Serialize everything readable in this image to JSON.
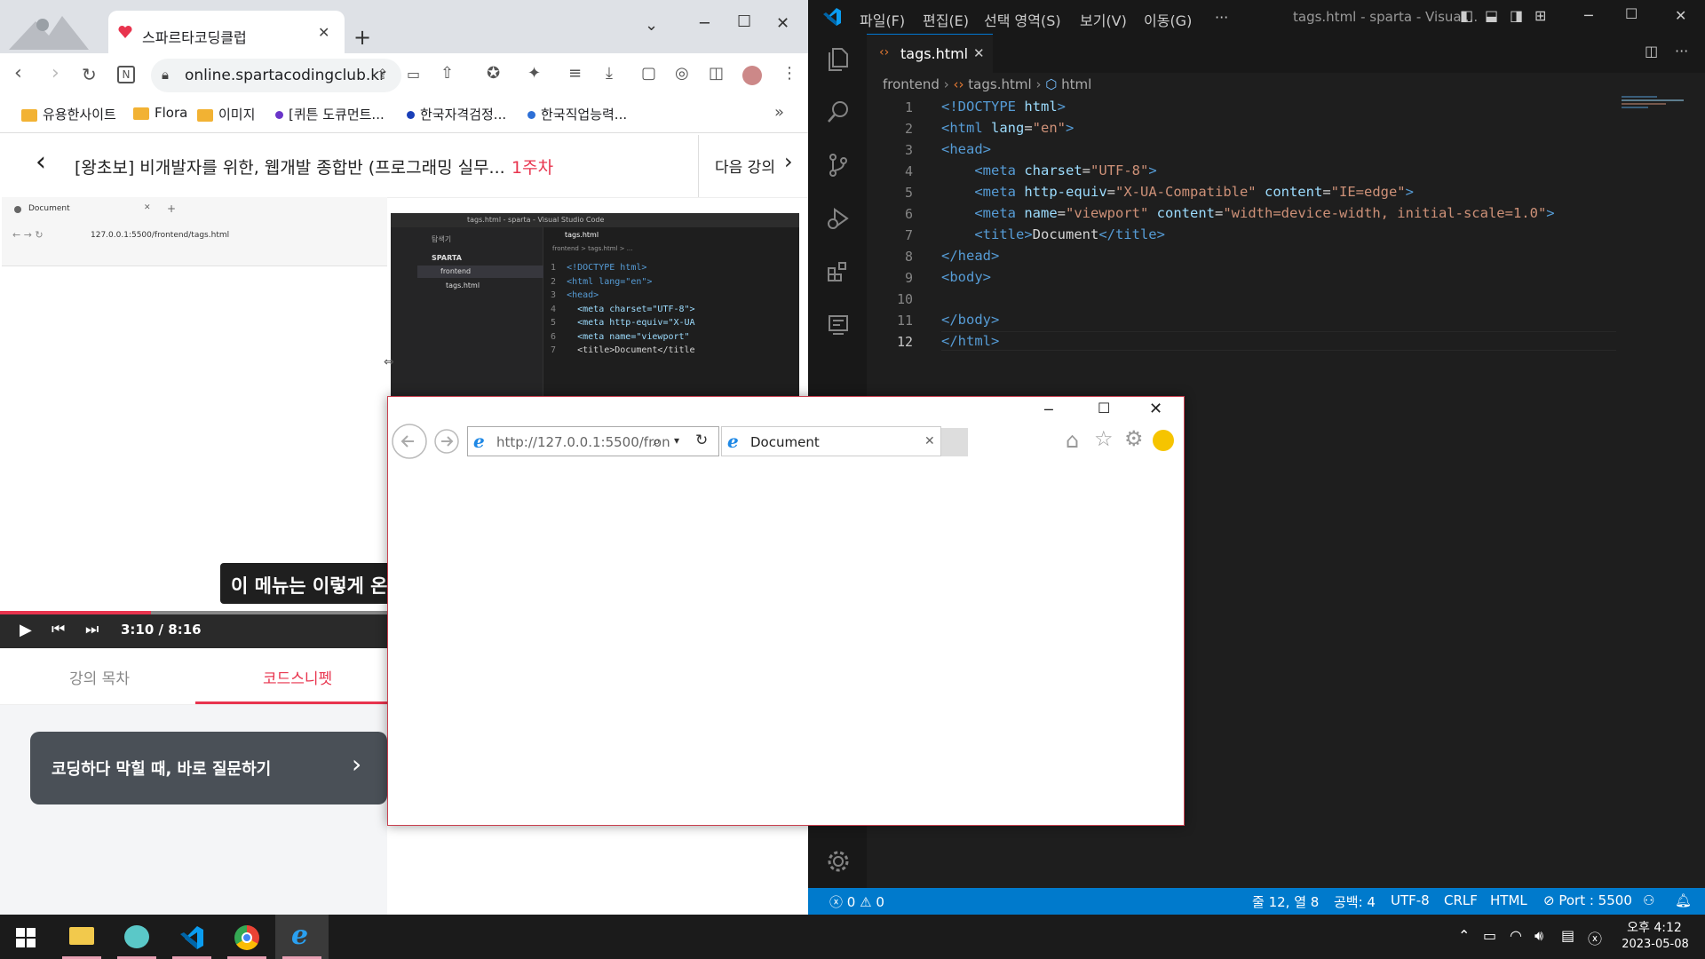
{
  "chrome": {
    "tab_title": "스파르타코딩클럽",
    "url": "online.spartacodingclub.kr",
    "bookmarks": [
      {
        "label": "유용한사이트",
        "kind": "folder"
      },
      {
        "label": "Flora",
        "kind": "folder"
      },
      {
        "label": "이미지",
        "kind": "folder"
      },
      {
        "label": "[퀴튼 도큐먼트...",
        "kind": "dot",
        "color": "#6a35c9"
      },
      {
        "label": "한국자격검정...",
        "kind": "dot",
        "color": "#1a3fb8"
      },
      {
        "label": "한국직업능력...",
        "kind": "dot",
        "color": "#2d6fd6"
      }
    ]
  },
  "lecture": {
    "title": "[왕초보] 비개발자를 위한, 웹개발 종합반 (프로그래밍 실무...",
    "week": "1주차",
    "next_label": "다음 강의",
    "subtitle": "이 메뉴는 이렇게 온",
    "time_current": "3:10",
    "time_sep": "/",
    "time_total": "8:16",
    "progress": 0.39,
    "tab_toc": "강의 목차",
    "tab_snippet": "코드스니펫",
    "ask_label": "코딩하다 막힐 때, 바로 질문하기"
  },
  "mini_chrome": {
    "tab_title": "Document",
    "url": "127.0.0.1:5500/frontend/tags.html"
  },
  "mini_vscode": {
    "window_title": "tags.html - sparta - Visual Studio Code",
    "explorer_title": "탐색기",
    "tree_root": "SPARTA",
    "tree_folder": "frontend",
    "tree_file": "tags.html",
    "tab_label": "tags.html",
    "breadcrumb": "frontend > tags.html > ...",
    "lines": [
      {
        "n": "1",
        "html": "<!DOCTYPE html>"
      },
      {
        "n": "2",
        "html": "<html lang=\"en\">"
      },
      {
        "n": "3",
        "html": "<head>"
      },
      {
        "n": "4",
        "html": "  <meta charset=\"UTF-8\">"
      },
      {
        "n": "5",
        "html": "  <meta http-equiv=\"X-UA"
      },
      {
        "n": "6",
        "html": "  <meta name=\"viewport\""
      },
      {
        "n": "7",
        "html": "  <title>Document</title"
      }
    ]
  },
  "vscode": {
    "menus": [
      "파일(F)",
      "편집(E)",
      "선택 영역(S)",
      "보기(V)",
      "이동(G)",
      "···"
    ],
    "window_title": "tags.html - sparta - Visual...",
    "tab_label": "tags.html",
    "breadcrumb": {
      "folder": "frontend",
      "file": "tags.html",
      "symbol": "html"
    },
    "line_numbers": [
      "1",
      "2",
      "3",
      "4",
      "5",
      "6",
      "7",
      "8",
      "9",
      "10",
      "11",
      "12"
    ],
    "status": {
      "errors": "0",
      "warnings": "0",
      "position": "줄 12, 열 8",
      "spaces": "공백: 4",
      "encoding": "UTF-8",
      "eol": "CRLF",
      "language": "HTML",
      "port": "Port : 5500"
    }
  },
  "ie": {
    "url": "http://127.0.0.1:5500/fron",
    "tab_title": "Document"
  },
  "taskbar": {
    "time": "오후 4:12",
    "date": "2023-05-08"
  }
}
